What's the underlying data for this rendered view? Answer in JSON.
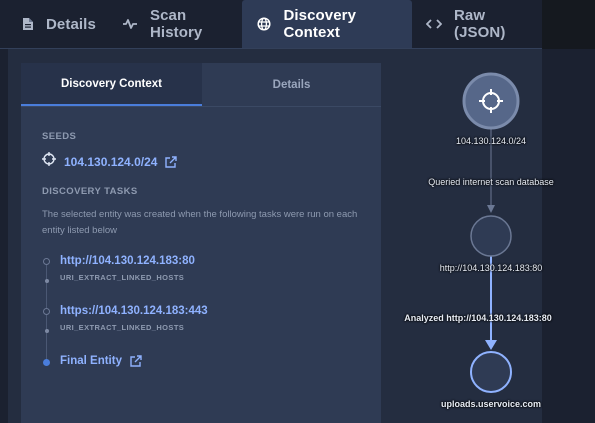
{
  "top_tabs": [
    {
      "label": "Details",
      "icon": "document-icon"
    },
    {
      "label": "Scan History",
      "icon": "pulse-icon"
    },
    {
      "label": "Discovery Context",
      "icon": "globe-icon",
      "active": true
    },
    {
      "label": "Raw (JSON)",
      "icon": "code-icon"
    }
  ],
  "card": {
    "tabs": [
      {
        "label": "Discovery Context",
        "active": true
      },
      {
        "label": "Details"
      }
    ],
    "seeds_heading": "SEEDS",
    "seed_value": "104.130.124.0/24",
    "tasks_heading": "DISCOVERY TASKS",
    "tasks_description": "The selected entity was created when the following tasks were run on each entity listed below",
    "tasks": [
      {
        "link": "http://104.130.124.183:80",
        "task": "URI_EXTRACT_LINKED_HOSTS"
      },
      {
        "link": "https://104.130.124.183:443",
        "task": "URI_EXTRACT_LINKED_HOSTS"
      }
    ],
    "final_entity": "Final Entity"
  },
  "graph": {
    "nodes": [
      {
        "label": "104.130.124.0/24"
      },
      {
        "label": "http://104.130.124.183:80"
      },
      {
        "label": "uploads.uservoice.com"
      }
    ],
    "edges": [
      {
        "label": "Queried internet scan database"
      },
      {
        "label": "Analyzed http://104.130.124.183:80"
      }
    ]
  },
  "colors": {
    "accent": "#4a7ddb",
    "link": "#8fb2ff",
    "panel": "#2f3b54"
  }
}
